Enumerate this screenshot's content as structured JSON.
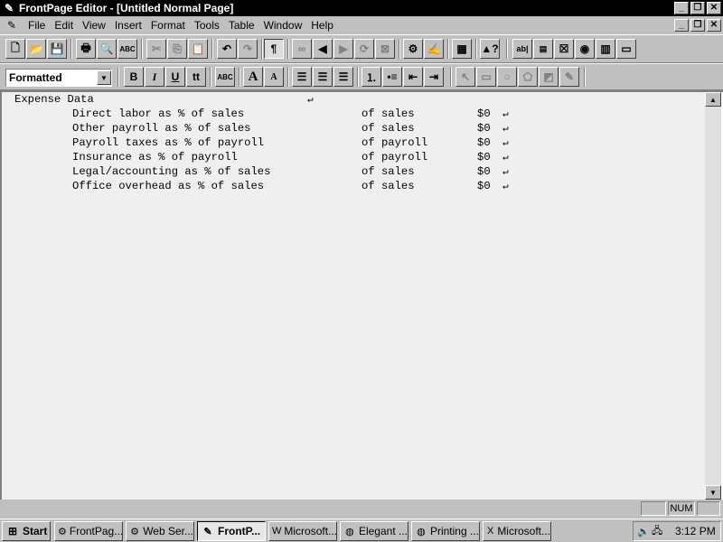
{
  "window": {
    "title": "FrontPage Editor - [Untitled Normal Page]"
  },
  "menu": {
    "items": [
      "File",
      "Edit",
      "View",
      "Insert",
      "Format",
      "Tools",
      "Table",
      "Window",
      "Help"
    ]
  },
  "format_toolbar": {
    "style_value": "Formatted",
    "bold_label": "B",
    "italic_label": "I",
    "underline_label": "U",
    "typewriter_label": "tt",
    "abc_label": "ABC",
    "increase_font_label": "A",
    "decrease_font_label": "A"
  },
  "document": {
    "heading": "Expense Data",
    "rows": [
      {
        "label": "Direct labor as % of sales",
        "unit": "of sales",
        "value": "$0"
      },
      {
        "label": "Other payroll as % of sales",
        "unit": "of sales",
        "value": "$0"
      },
      {
        "label": "Payroll taxes as % of payroll",
        "unit": "of payroll",
        "value": "$0"
      },
      {
        "label": "Insurance as % of payroll",
        "unit": "of payroll",
        "value": "$0"
      },
      {
        "label": "Legal/accounting as % of sales",
        "unit": "of sales",
        "value": "$0"
      },
      {
        "label": "Office overhead as % of sales",
        "unit": "of sales",
        "value": "$0"
      }
    ]
  },
  "statusbar": {
    "num": "NUM"
  },
  "taskbar": {
    "start": "Start",
    "tasks": [
      "FrontPag...",
      "Web Ser...",
      "FrontP...",
      "Microsoft...",
      "Elegant ...",
      "Printing ...",
      "Microsoft..."
    ],
    "time": "3:12 PM"
  },
  "colors": {
    "face": "#c0c0c0",
    "title_bar": "#000000",
    "editor_bg": "#efefef"
  }
}
